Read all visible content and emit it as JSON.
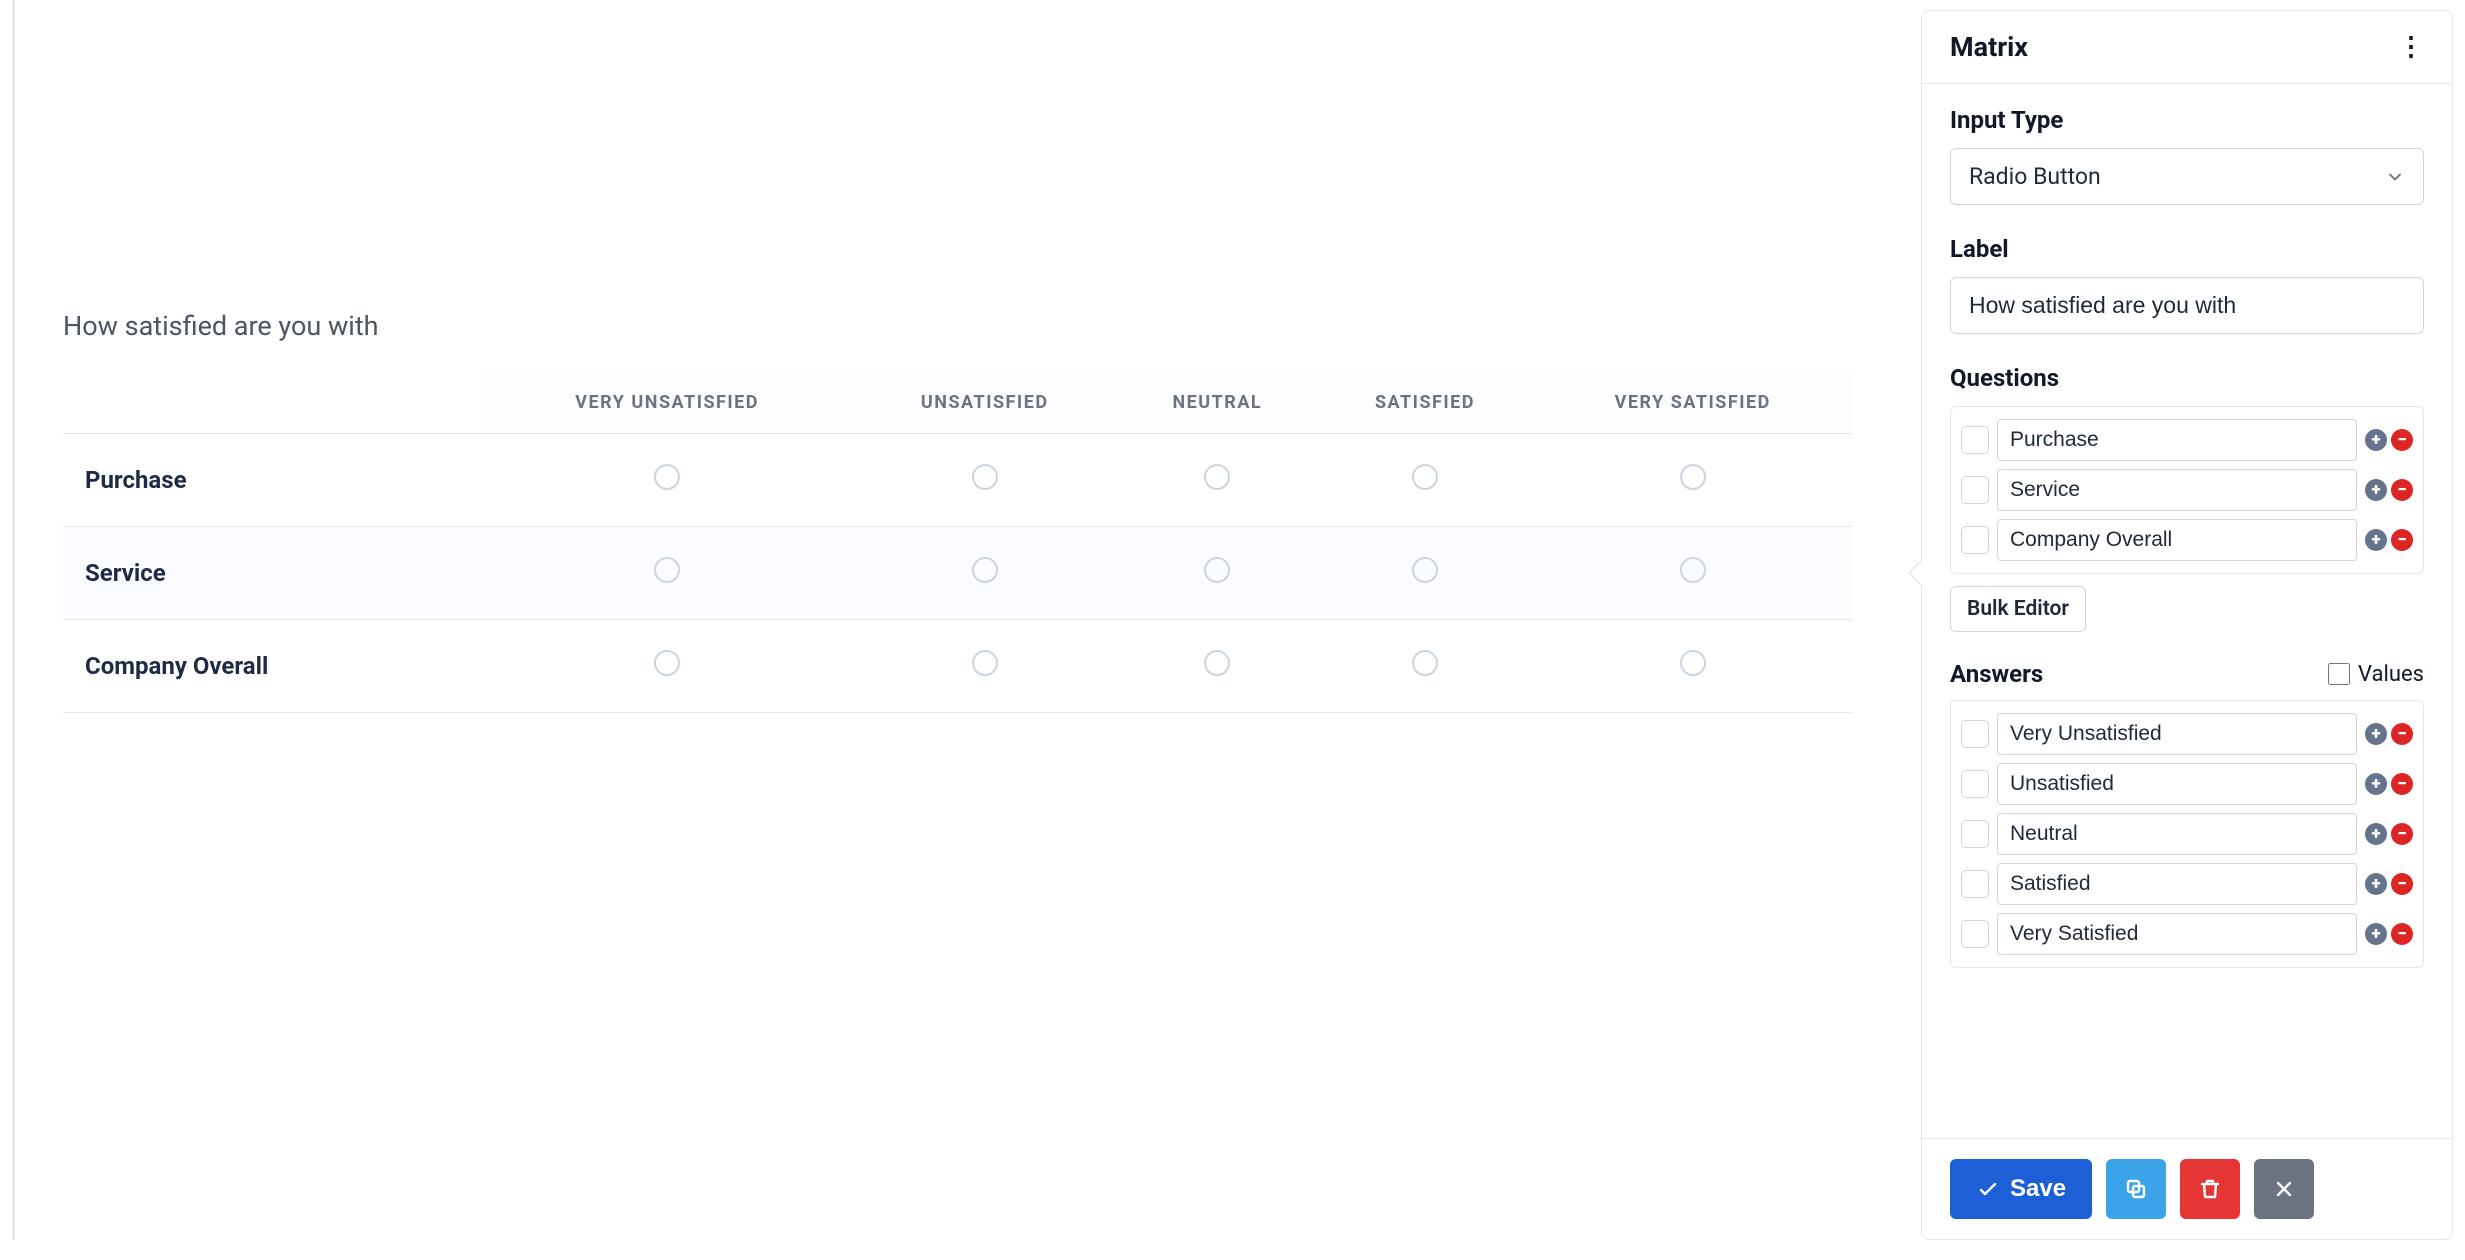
{
  "preview": {
    "question_label": "How satisfied are you with",
    "columns": [
      "VERY UNSATISFIED",
      "UNSATISFIED",
      "NEUTRAL",
      "SATISFIED",
      "VERY SATISFIED"
    ],
    "rows": [
      "Purchase",
      "Service",
      "Company Overall"
    ]
  },
  "panel": {
    "title": "Matrix",
    "input_type_label": "Input Type",
    "input_type_value": "Radio Button",
    "label_label": "Label",
    "label_value": "How satisfied are you with",
    "questions_label": "Questions",
    "questions": [
      "Purchase",
      "Service",
      "Company Overall"
    ],
    "bulk_editor_label": "Bulk Editor",
    "answers_label": "Answers",
    "values_toggle_label": "Values",
    "answers": [
      "Very Unsatisfied",
      "Unsatisfied",
      "Neutral",
      "Satisfied",
      "Very Satisfied"
    ],
    "buttons": {
      "save": "Save"
    }
  }
}
